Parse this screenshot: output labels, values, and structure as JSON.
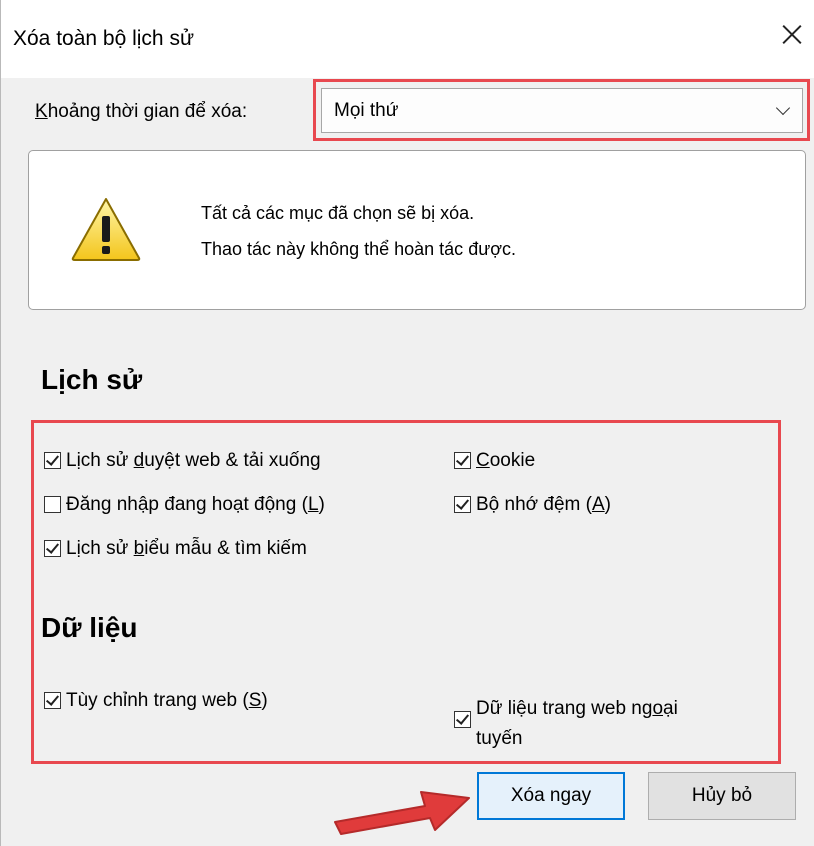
{
  "dialog": {
    "title": "Xóa toàn bộ lịch sử",
    "close_icon": "close-icon"
  },
  "time_range": {
    "label_access_key": "K",
    "label_rest": "hoảng thời gian để xóa:",
    "selected": "Mọi thứ"
  },
  "warning": {
    "icon": "warning-icon",
    "line1": "Tất cả các mục đã chọn sẽ bị xóa.",
    "line2": "Thao tác này không thể hoàn tác được."
  },
  "history": {
    "heading": "Lịch sử",
    "items": [
      {
        "pre": "Lịch sử ",
        "key": "d",
        "post": "uyệt web & tải xuống",
        "checked": true
      },
      {
        "pre": "",
        "key": "C",
        "post": "ookie",
        "checked": true
      },
      {
        "pre": "Đăng nhập đang hoạt động (",
        "key": "L",
        "post": ")",
        "checked": false
      },
      {
        "pre": "Bộ nhớ đệm (",
        "key": "A",
        "post": ")",
        "checked": true
      },
      {
        "pre": "Lịch sử ",
        "key": "b",
        "post": "iểu mẫu & tìm kiếm",
        "checked": true
      }
    ]
  },
  "data_section": {
    "heading": "Dữ liệu",
    "items": [
      {
        "pre": "Tùy chỉnh trang web (",
        "key": "S",
        "post": ")",
        "checked": true
      },
      {
        "pre": "Dữ liệu trang web ng",
        "key": "o",
        "post": "ại",
        "line2": "tuyến",
        "checked": true
      }
    ]
  },
  "buttons": {
    "clear": "Xóa ngay",
    "cancel": "Hủy bỏ"
  },
  "colors": {
    "highlight": "#e8484f",
    "focus": "#0078d7"
  }
}
